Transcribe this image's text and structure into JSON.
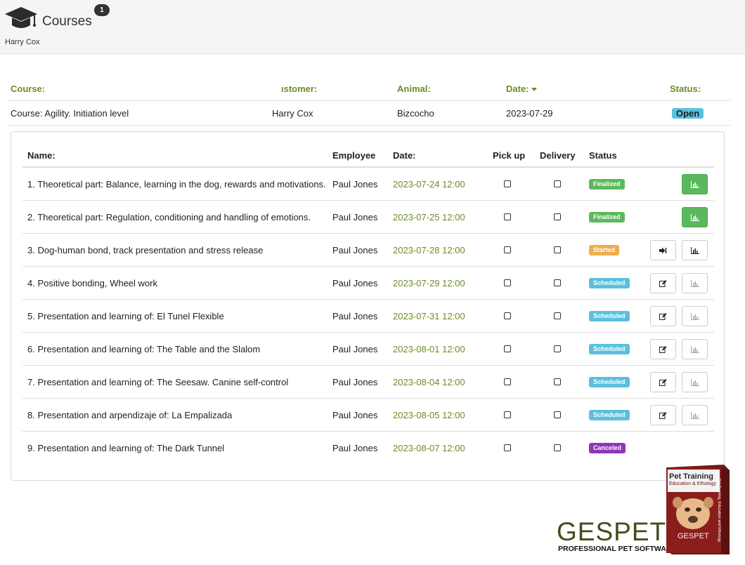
{
  "header": {
    "title": "Courses",
    "badge_count": "1",
    "user_name": "Harry Cox"
  },
  "course_table": {
    "columns": {
      "course": "Course:",
      "customer": "ıstomer:",
      "animal": "Animal:",
      "date": "Date:",
      "status": "Status:"
    },
    "row": {
      "course": "Course: Agility. Initiation level",
      "customer": "Harry Cox",
      "animal": "Bizcocho",
      "date": "2023-07-29",
      "status": "Open"
    }
  },
  "sessions": {
    "columns": {
      "name": "Name:",
      "employee": "Employee",
      "date": "Date:",
      "pickup": "Pick up",
      "delivery": "Delivery",
      "status": "Status"
    },
    "rows": [
      {
        "name": "1. Theoretical part: Balance, learning in the dog, rewards and motivations.",
        "employee": "Paul Jones",
        "date": "2023-07-24 12:00",
        "status": "Finalized"
      },
      {
        "name": "2. Theoretical part: Regulation, conditioning and handling of emotions.",
        "employee": "Paul Jones",
        "date": "2023-07-25 12:00",
        "status": "Finalized"
      },
      {
        "name": "3. Dog-human bond, track presentation and stress release",
        "employee": "Paul Jones",
        "date": "2023-07-28 12:00",
        "status": "Started"
      },
      {
        "name": "4. Positive bonding, Wheel work",
        "employee": "Paul Jones",
        "date": "2023-07-29 12:00",
        "status": "Scheduled"
      },
      {
        "name": "5. Presentation and learning of: El Tunel Flexible",
        "employee": "Paul Jones",
        "date": "2023-07-31 12:00",
        "status": "Scheduled"
      },
      {
        "name": "6. Presentation and learning of: The Table and the Slalom",
        "employee": "Paul Jones",
        "date": "2023-08-01 12:00",
        "status": "Scheduled"
      },
      {
        "name": "7. Presentation and learning of: The Seesaw. Canine self-control",
        "employee": "Paul Jones",
        "date": "2023-08-04 12:00",
        "status": "Scheduled"
      },
      {
        "name": "8. Presentation and arpendizaje of: La Empalizada",
        "employee": "Paul Jones",
        "date": "2023-08-05 12:00",
        "status": "Scheduled"
      },
      {
        "name": "9. Presentation and learning of: The Dark Tunnel",
        "employee": "Paul Jones",
        "date": "2023-08-07 12:00",
        "status": "Canceled"
      }
    ]
  },
  "branding": {
    "logo_text": "GESPET",
    "tagline": "PROFESSIONAL PET SOFTWARE",
    "box_title": "Pet Training",
    "box_subtitle": "Education & Ethology",
    "box_brand": "GESPET",
    "box_side": "Pet Training, Education and Ethology"
  },
  "icons": {
    "header": "graduation-cap-icon",
    "edit": "edit-icon",
    "enter": "sign-in-icon",
    "chart": "bar-chart-icon"
  },
  "colors": {
    "accent_green": "#6b8e23",
    "open": "#5bc0de",
    "scheduled": "#5bc0de",
    "finalized": "#5cb85c",
    "started": "#f0ad4e",
    "canceled": "#8e35b8"
  }
}
